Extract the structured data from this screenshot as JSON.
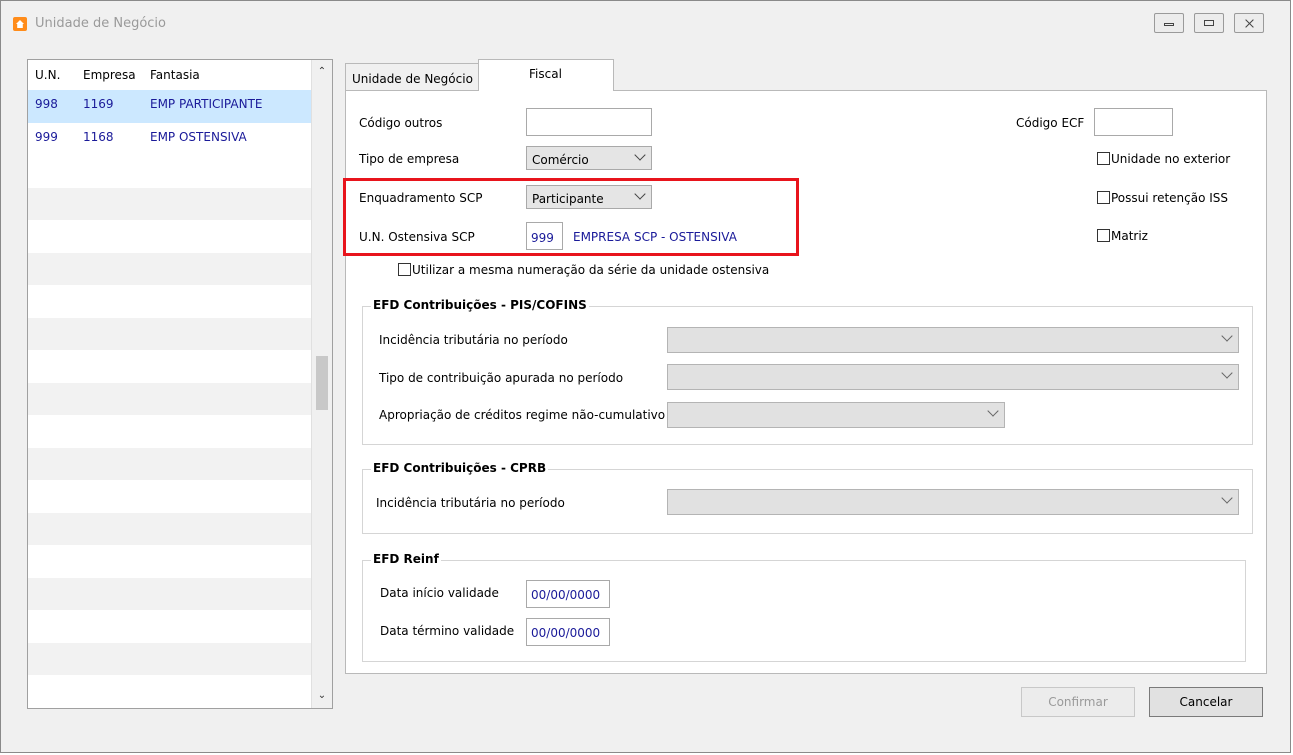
{
  "window": {
    "title": "Unidade de Negócio"
  },
  "list": {
    "columns": [
      "U.N.",
      "Empresa",
      "Fantasia"
    ],
    "rows": [
      {
        "un": "998",
        "empresa": "1169",
        "fantasia": "EMP PARTICIPANTE"
      },
      {
        "un": "999",
        "empresa": "1168",
        "fantasia": "EMP OSTENSIVA"
      }
    ]
  },
  "tabs": {
    "unidade": "Unidade de Negócio",
    "fiscal": "Fiscal"
  },
  "fiscal": {
    "codigo_outros_label": "Código outros",
    "codigo_outros_value": "",
    "codigo_ecf_label": "Código ECF",
    "codigo_ecf_value": "",
    "tipo_empresa_label": "Tipo de empresa",
    "tipo_empresa_value": "Comércio",
    "enquadramento_label": "Enquadramento SCP",
    "enquadramento_value": "Participante",
    "un_ostensiva_label": "U.N. Ostensiva SCP",
    "un_ostensiva_code": "999",
    "un_ostensiva_name": "EMPRESA SCP - OSTENSIVA",
    "checkbox_exterior": "Unidade no exterior",
    "checkbox_iss": "Possui retenção ISS",
    "checkbox_matriz": "Matriz",
    "checkbox_numeracao": "Utilizar a mesma numeração da série da unidade ostensiva"
  },
  "efd_pis": {
    "title": "EFD Contribuições - PIS/COFINS",
    "incidencia_label": "Incidência tributária no período",
    "tipo_label": "Tipo de contribuição apurada no período",
    "apropriacao_label": "Apropriação de créditos regime não-cumulativo"
  },
  "efd_cprb": {
    "title": "EFD Contribuições - CPRB",
    "incidencia_label": "Incidência tributária no período"
  },
  "efd_reinf": {
    "title": "EFD Reinf",
    "inicio_label": "Data início validade",
    "inicio_value": "00/00/0000",
    "termino_label": "Data término validade",
    "termino_value": "00/00/0000"
  },
  "buttons": {
    "confirmar": "Confirmar",
    "cancelar": "Cancelar"
  },
  "colors": {
    "highlight": "#e8141c",
    "selected_row": "#cce8ff",
    "link_text": "#1a1a99"
  }
}
